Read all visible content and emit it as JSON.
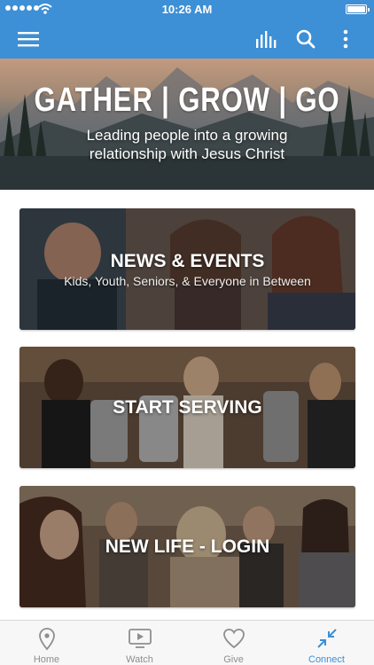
{
  "status_bar": {
    "time": "10:26 AM"
  },
  "hero": {
    "title": "GATHER | GROW | GO",
    "subtitle": "Leading people into a growing relationship with Jesus Christ"
  },
  "cards": [
    {
      "title": "NEWS & EVENTS",
      "subtitle": "Kids, Youth, Seniors, & Everyone in Between"
    },
    {
      "title": "START SERVING"
    },
    {
      "title": "NEW LIFE - LOGIN"
    }
  ],
  "tabs": [
    {
      "label": "Home",
      "icon": "location-pin-icon"
    },
    {
      "label": "Watch",
      "icon": "video-icon"
    },
    {
      "label": "Give",
      "icon": "heart-icon"
    },
    {
      "label": "Connect",
      "icon": "arrows-in-icon",
      "active": true
    }
  ],
  "colors": {
    "accent": "#3d8fd6",
    "tab_inactive": "#8e8e93",
    "tabbar_bg": "#f7f7f7"
  }
}
